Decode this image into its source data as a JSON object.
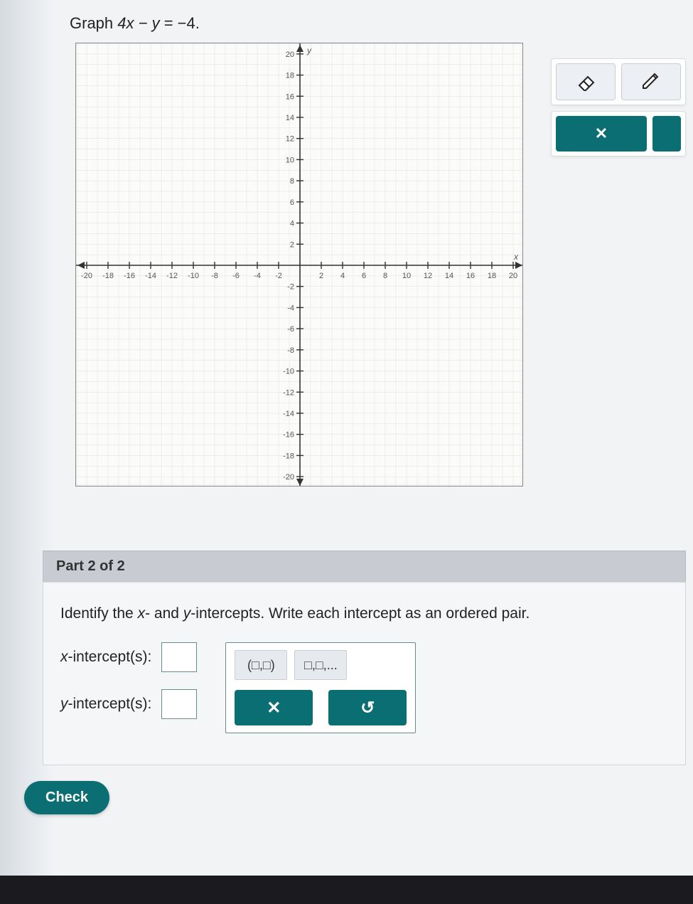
{
  "prompt": {
    "pre": "Graph ",
    "eq_lhs": "4x − y",
    "eq_rhs": " = −4."
  },
  "chart_data": {
    "type": "scatter",
    "title": "",
    "xlabel": "x",
    "ylabel": "y",
    "x_ticks": [
      -20,
      -18,
      -16,
      -14,
      -12,
      -10,
      -8,
      -6,
      -4,
      -2,
      2,
      4,
      6,
      8,
      10,
      12,
      14,
      16,
      18,
      20
    ],
    "y_ticks": [
      20,
      18,
      16,
      14,
      12,
      10,
      8,
      6,
      4,
      2,
      -2,
      -4,
      -6,
      -8,
      -10,
      -12,
      -14,
      -16,
      -18,
      -20
    ],
    "xlim": [
      -21,
      21
    ],
    "ylim": [
      -21,
      21
    ],
    "grid": true,
    "series": []
  },
  "tools": {
    "eraser": "eraser-icon",
    "pencil": "pencil-icon",
    "close": "✕"
  },
  "part2": {
    "header": "Part 2 of 2",
    "instruction_pre": "Identify the ",
    "instruction_mid1": "x",
    "instruction_mid2": "- and ",
    "instruction_mid3": "y",
    "instruction_post": "-intercepts. Write each intercept as an ordered pair.",
    "xlabel_pre": "x",
    "xlabel_post": "-intercept(s):",
    "ylabel_pre": "y",
    "ylabel_post": "-intercept(s):",
    "x_value": "",
    "y_value": ""
  },
  "keys": {
    "pair": "(□,□)",
    "list": "□,□,...",
    "clear": "✕",
    "undo": "↺"
  },
  "check": "Check"
}
